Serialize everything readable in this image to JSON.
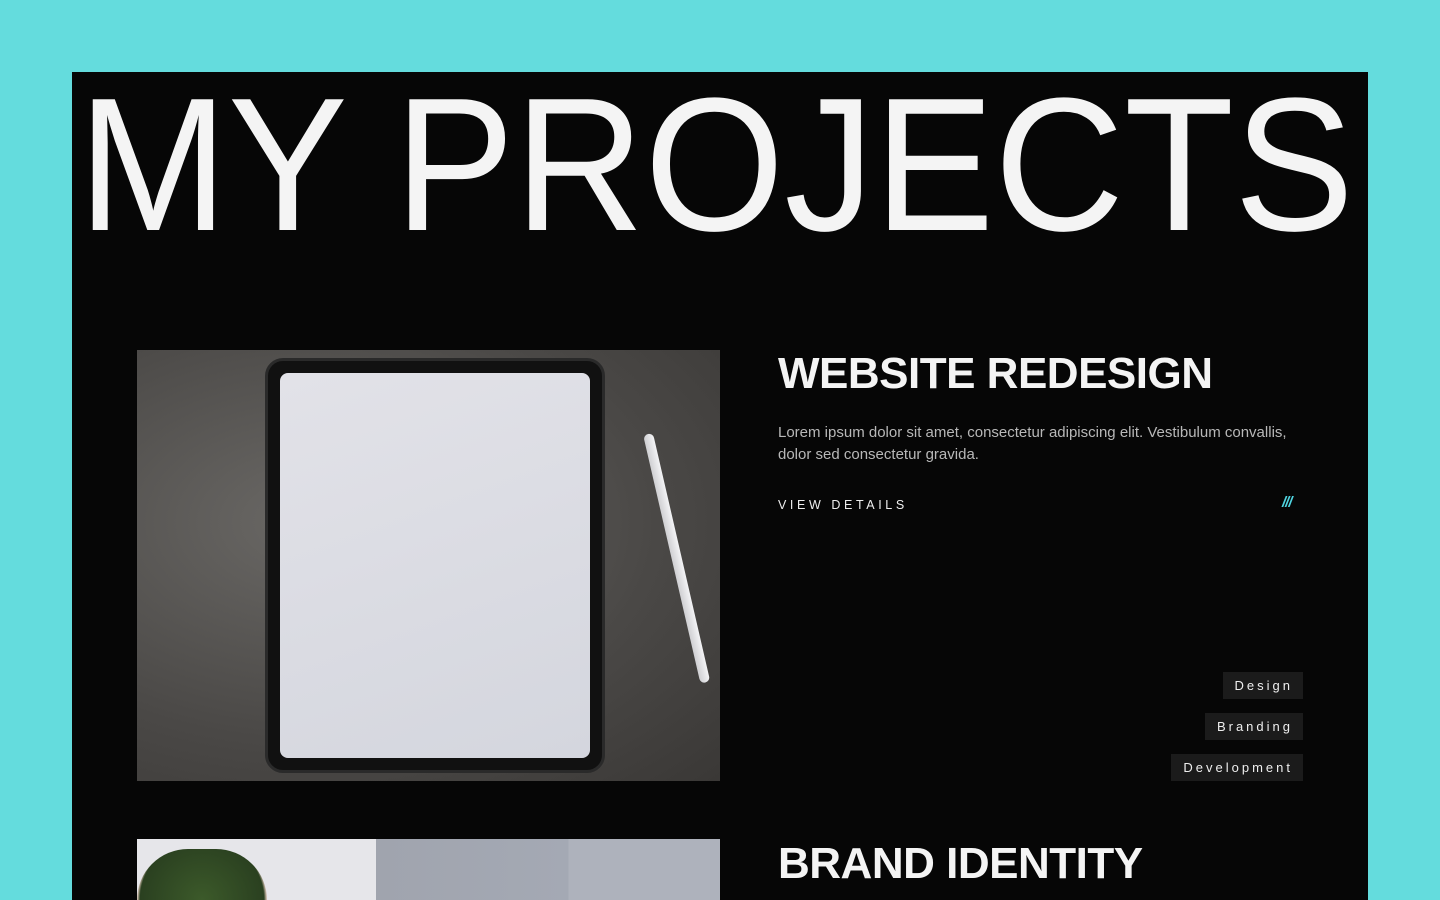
{
  "page": {
    "title": "MY PROJECTS"
  },
  "projects": [
    {
      "title": "WEBSITE REDESIGN",
      "description": "Lorem ipsum dolor sit amet, consectetur adipiscing elit. Vestibulum convallis, dolor sed consectetur gravida.",
      "link": "VIEW DETAILS",
      "decoration": "///",
      "tags": [
        "Design",
        "Branding",
        "Development"
      ]
    },
    {
      "title": "BRAND IDENTITY"
    }
  ],
  "colors": {
    "background": "#64dcdd",
    "panel": "#060606",
    "accent": "#4fd4e0"
  }
}
